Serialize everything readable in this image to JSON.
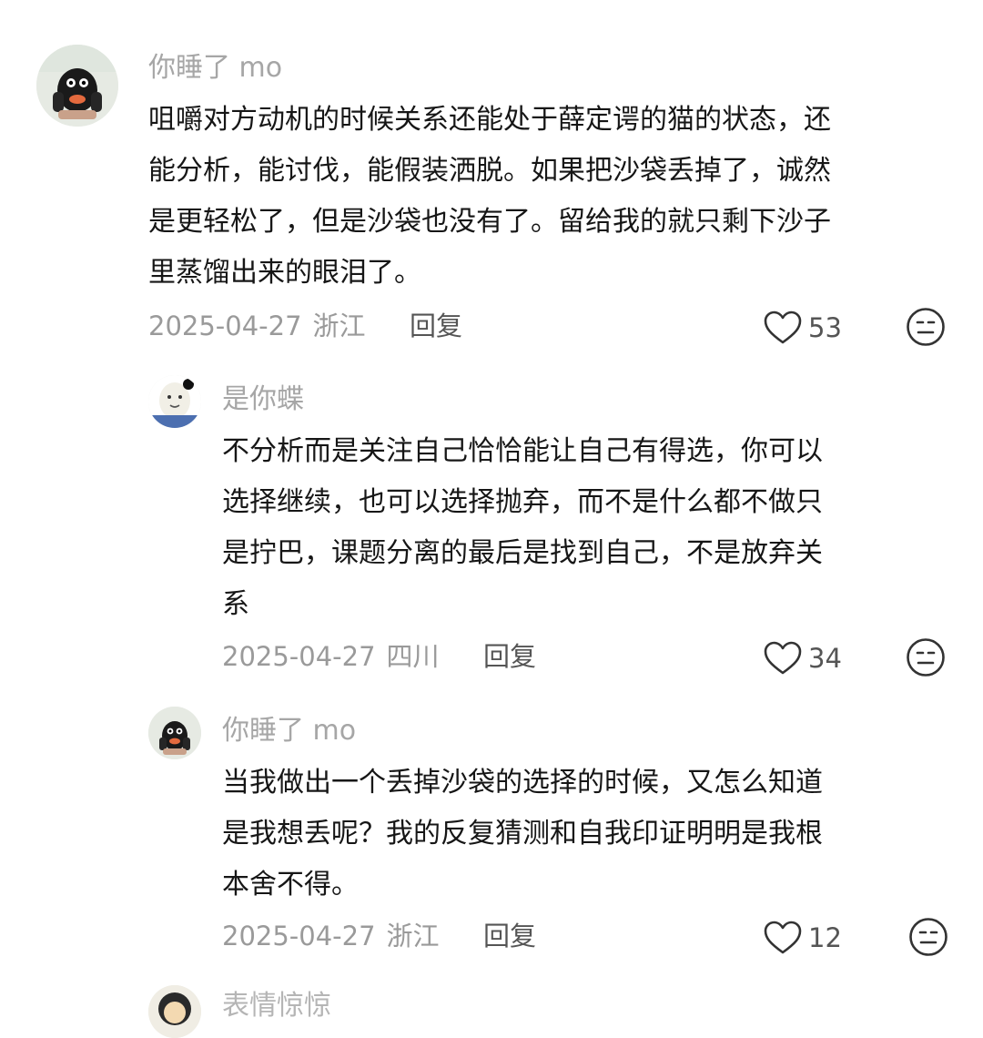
{
  "comments": [
    {
      "username": "你睡了 mo",
      "avatar_icon": "penguin-avatar",
      "lines": [
        "咀嚼对方动机的时候关系还能处于薛定谔的猫的状态，还",
        "能分析，能讨伐，能假装洒脱。如果把沙袋丢掉了，诚然",
        "是更轻松了，但是沙袋也没有了。留给我的就只剩下沙子",
        "里蒸馏出来的眼泪了。"
      ],
      "date": "2025-04-27",
      "location": "浙江",
      "reply_label": "回复",
      "likes": "53"
    },
    {
      "username": "是你蝶",
      "avatar_icon": "cartoon-face-avatar",
      "lines": [
        "不分析而是关注自己恰恰能让自己有得选，你可以",
        "选择继续，也可以选择抛弃，而不是什么都不做只",
        "是拧巴，课题分离的最后是找到自己，不是放弃关",
        "系"
      ],
      "date": "2025-04-27",
      "location": "四川",
      "reply_label": "回复",
      "likes": "34"
    },
    {
      "username": "你睡了 mo",
      "avatar_icon": "penguin-avatar",
      "lines": [
        "当我做出一个丢掉沙袋的选择的时候，又怎么知道",
        "是我想丢呢？我的反复猜测和自我印证明明是我根",
        "本舍不得。"
      ],
      "date": "2025-04-27",
      "location": "浙江",
      "reply_label": "回复",
      "likes": "12"
    }
  ],
  "next_comment_username_partial": "表情惊惊"
}
